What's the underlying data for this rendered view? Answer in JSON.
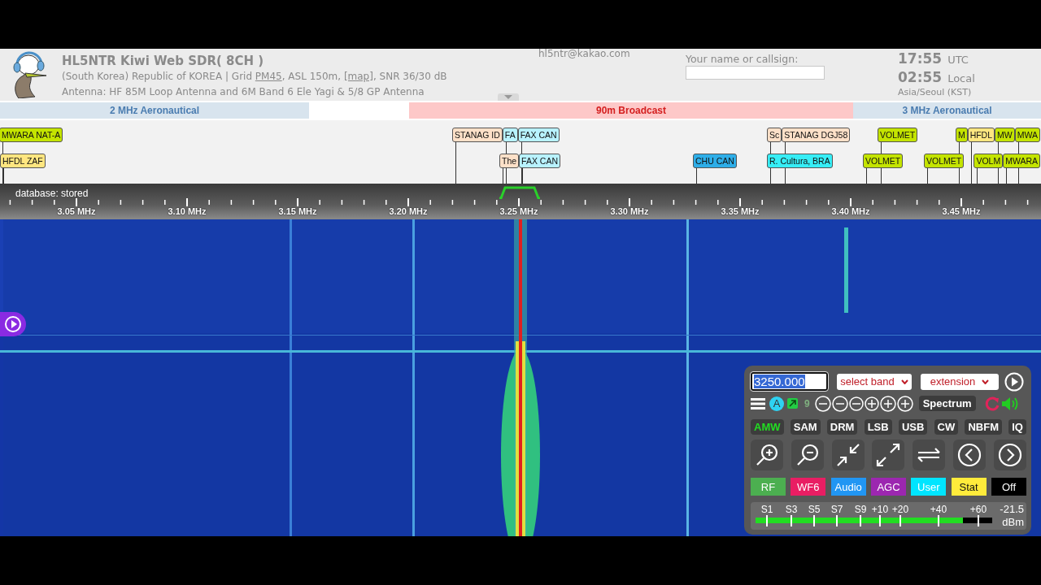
{
  "header": {
    "title": "HL5NTR Kiwi Web SDR( 8CH )",
    "location": {
      "prefix": "(South Korea) Republic of KOREA | Grid ",
      "grid": "PM45",
      "middle": ", ASL 150m, ",
      "map": "[map]",
      "suffix": ", SNR 36/30 dB"
    },
    "antenna": "Antenna: HF 85M Loop Antenna and 6M Band 6 Ele Yagi & 5/8 GP Antenna",
    "email": "hl5ntr@kakao.com",
    "name_field": {
      "label": "Your name or callsign:"
    },
    "clock": {
      "utc_time": "17:55",
      "utc_label": "UTC",
      "local_time": "02:55",
      "local_label": "Local",
      "timezone": "Asia/Seoul (KST)"
    }
  },
  "bands": [
    {
      "label": "2 MHz Aeronautical",
      "kind": "aeronautical"
    },
    {
      "label": "90m Broadcast",
      "kind": "broadcast"
    },
    {
      "label": "3 MHz Aeronautical",
      "kind": "aeronautical"
    }
  ],
  "station_rows": [
    {
      "labels": [
        {
          "text": "MWARA NAT-A",
          "color": "#c4e400"
        },
        {
          "text": "STANAG ID",
          "color": "#fde0c8"
        },
        {
          "text": "FA",
          "color": "#b8f2ff"
        },
        {
          "text": "FAX CAN",
          "color": "#b8f2ff"
        },
        {
          "text": "Sc",
          "color": "#fde0c8"
        },
        {
          "text": "STANAG DGJ58",
          "color": "#fde0c8"
        },
        {
          "text": "VOLMET",
          "color": "#c4e400"
        },
        {
          "text": "M",
          "color": "#c4e400"
        },
        {
          "text": "HFDL",
          "color": "#ffe680"
        },
        {
          "text": "MW",
          "color": "#c4e400"
        },
        {
          "text": "MWA",
          "color": "#c4e400"
        }
      ]
    },
    {
      "labels": [
        {
          "text": "HFDL ZAF",
          "color": "#ffe680"
        },
        {
          "text": "The",
          "color": "#fde0c8"
        },
        {
          "text": "FAX CAN",
          "color": "#b8f2ff"
        },
        {
          "text": "CHU CAN",
          "color": "#2eaee8"
        },
        {
          "text": "R. Cultura, BRA",
          "color": "#36eef6"
        },
        {
          "text": "VOLMET",
          "color": "#c4e400"
        },
        {
          "text": "VOLMET",
          "color": "#c4e400"
        },
        {
          "text": "VOLM",
          "color": "#c4e400"
        },
        {
          "text": "MWARA",
          "color": "#c4e400"
        }
      ]
    }
  ],
  "scale": {
    "status": "database: stored",
    "labels": [
      "3.05 MHz",
      "3.10 MHz",
      "3.15 MHz",
      "3.20 MHz",
      "3.25 MHz",
      "3.30 MHz",
      "3.35 MHz",
      "3.40 MHz",
      "3.45 MHz"
    ]
  },
  "panel": {
    "frequency": "3250.000",
    "band_select": "select band",
    "extension_select": "extension",
    "channel_badge": "A",
    "count": "9",
    "spectrum_button": "Spectrum",
    "modes": [
      {
        "label": "AMW",
        "selected": true
      },
      {
        "label": "SAM",
        "selected": false
      },
      {
        "label": "DRM",
        "selected": false
      },
      {
        "label": "LSB",
        "selected": false
      },
      {
        "label": "USB",
        "selected": false
      },
      {
        "label": "CW",
        "selected": false
      },
      {
        "label": "NBFM",
        "selected": false
      },
      {
        "label": "IQ",
        "selected": false
      }
    ],
    "tabs": [
      {
        "label": "RF",
        "color": "#4caf50"
      },
      {
        "label": "WF6",
        "color": "#e91e63"
      },
      {
        "label": "Audio",
        "color": "#2196f3"
      },
      {
        "label": "AGC",
        "color": "#9c27b0"
      },
      {
        "label": "User",
        "color": "#00e5ff"
      },
      {
        "label": "Stat",
        "color": "#ffeb3b"
      },
      {
        "label": "Off",
        "color": "#000000"
      }
    ],
    "meter": {
      "scale": [
        "S1",
        "S3",
        "S5",
        "S7",
        "S9",
        "+10",
        "+20",
        "+40",
        "+60"
      ],
      "reading": "-21.5",
      "unit": "dBm",
      "level": 0.876
    }
  }
}
